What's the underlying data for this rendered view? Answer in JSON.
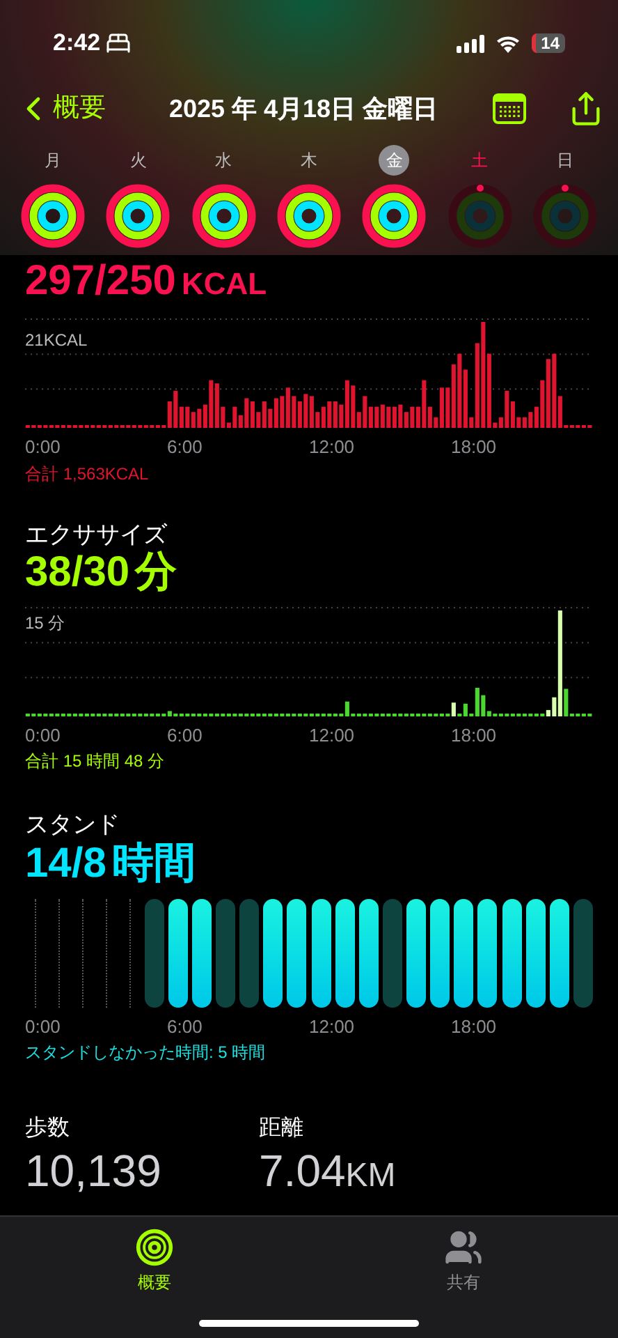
{
  "status_bar": {
    "time": "2:42",
    "battery": "14"
  },
  "nav": {
    "back": "概要",
    "title": "2025 年 4月18日 金曜日"
  },
  "days": [
    {
      "label": "月",
      "selected": false,
      "today": false,
      "closed": true
    },
    {
      "label": "火",
      "selected": false,
      "today": false,
      "closed": true
    },
    {
      "label": "水",
      "selected": false,
      "today": false,
      "closed": true
    },
    {
      "label": "木",
      "selected": false,
      "today": false,
      "closed": true
    },
    {
      "label": "金",
      "selected": true,
      "today": false,
      "closed": true
    },
    {
      "label": "土",
      "selected": false,
      "today": true,
      "closed": false
    },
    {
      "label": "日",
      "selected": false,
      "today": false,
      "closed": false
    }
  ],
  "move": {
    "value": "297/250",
    "unit": "KCAL",
    "max_label": "21KCAL",
    "x_labels": [
      "0:00",
      "6:00",
      "12:00",
      "18:00"
    ],
    "total": "合計 1,563KCAL"
  },
  "exercise": {
    "title": "エクササイズ",
    "value": "38/30",
    "unit": "分",
    "max_label": "15 分",
    "x_labels": [
      "0:00",
      "6:00",
      "12:00",
      "18:00"
    ],
    "total": "合計 15 時間 48 分"
  },
  "stand": {
    "title": "スタンド",
    "value": "14/8",
    "unit": "時間",
    "x_labels": [
      "0:00",
      "6:00",
      "12:00",
      "18:00"
    ],
    "note": "スタンドしなかった時間: 5 時間",
    "hours": [
      {
        "kind": "empty"
      },
      {
        "kind": "empty"
      },
      {
        "kind": "empty"
      },
      {
        "kind": "empty"
      },
      {
        "kind": "empty"
      },
      {
        "kind": "missed"
      },
      {
        "kind": "stood"
      },
      {
        "kind": "stood"
      },
      {
        "kind": "missed"
      },
      {
        "kind": "missed"
      },
      {
        "kind": "stood"
      },
      {
        "kind": "stood"
      },
      {
        "kind": "stood"
      },
      {
        "kind": "stood"
      },
      {
        "kind": "stood"
      },
      {
        "kind": "missed"
      },
      {
        "kind": "stood"
      },
      {
        "kind": "stood"
      },
      {
        "kind": "stood"
      },
      {
        "kind": "stood"
      },
      {
        "kind": "stood"
      },
      {
        "kind": "stood"
      },
      {
        "kind": "stood"
      },
      {
        "kind": "missed"
      }
    ]
  },
  "stats": [
    {
      "label": "歩数",
      "value": "10,139"
    },
    {
      "label": "距離",
      "value": "7.04",
      "unit": "KM"
    }
  ],
  "tabs": [
    {
      "label": "概要",
      "selected": true
    },
    {
      "label": "共有",
      "selected": false
    }
  ]
}
